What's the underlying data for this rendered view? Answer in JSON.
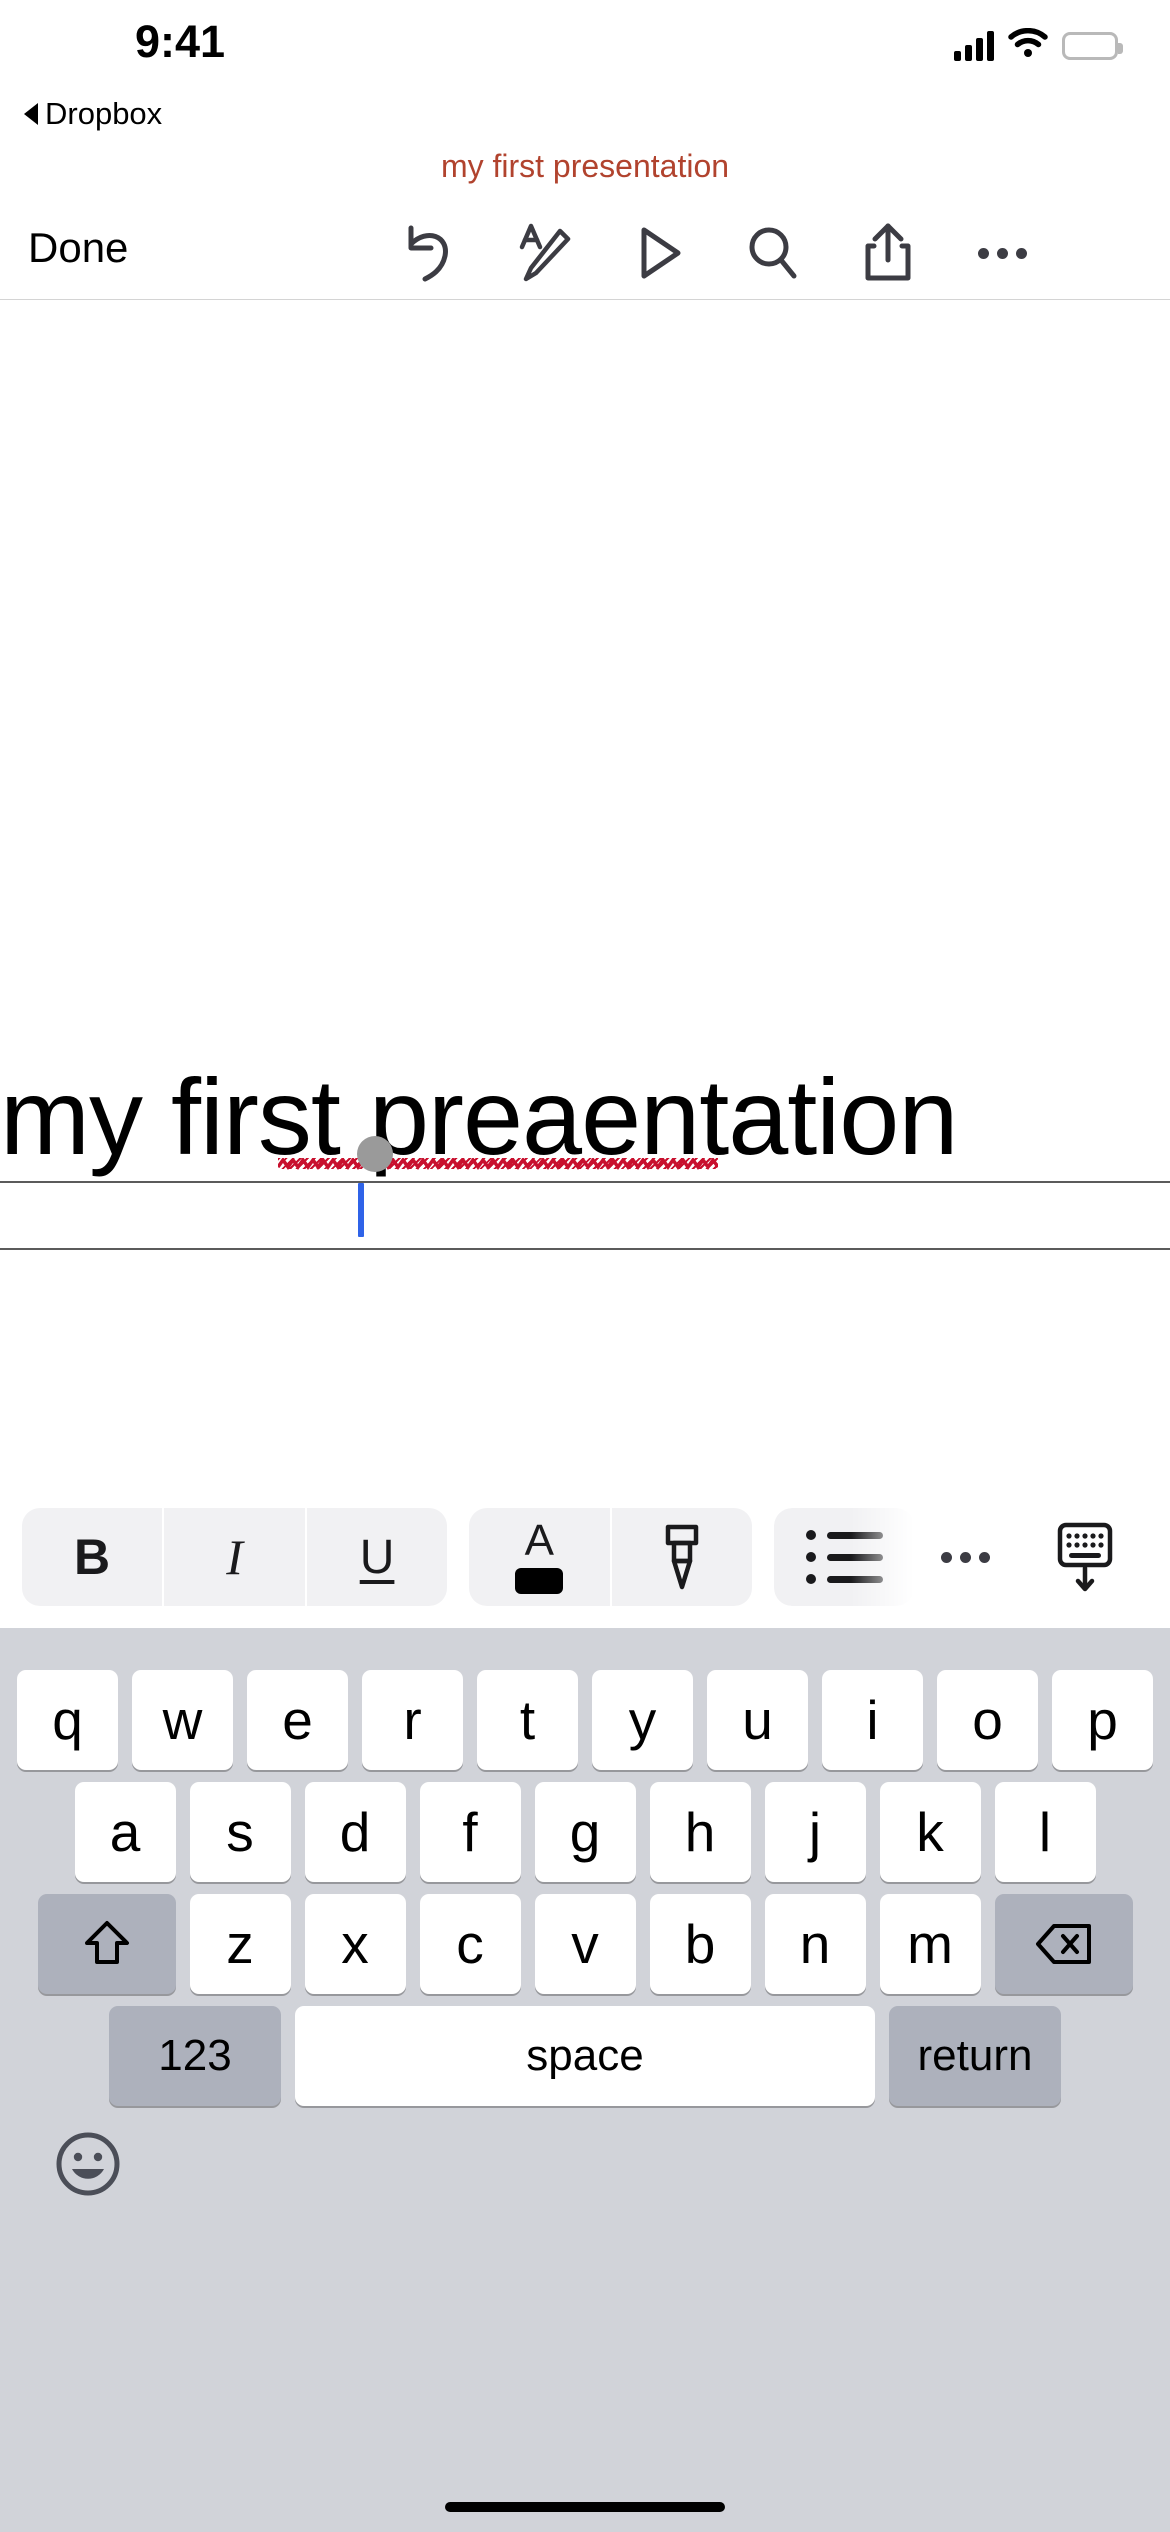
{
  "status_bar": {
    "time": "9:41",
    "signal_icon": "cellular-bars-icon",
    "wifi_icon": "wifi-icon",
    "battery_icon": "battery-full-icon"
  },
  "back_link": {
    "label": "Dropbox",
    "icon": "back-triangle-icon"
  },
  "document": {
    "title": "my first presentation",
    "title_color": "#b1432e"
  },
  "toolbar": {
    "done_label": "Done",
    "items": [
      {
        "name": "undo-icon",
        "label": "Undo"
      },
      {
        "name": "annotate-icon",
        "label": "Annotate"
      },
      {
        "name": "play-icon",
        "label": "Play"
      },
      {
        "name": "search-icon",
        "label": "Search"
      },
      {
        "name": "share-icon",
        "label": "Share"
      },
      {
        "name": "more-icon",
        "label": "More"
      }
    ]
  },
  "slide": {
    "heading_text": "my first preaentation",
    "misspelled_word": "preaentation",
    "caret_color": "#2f63e8",
    "handle_color": "#9a9a9a",
    "divider_color": "#5b5b5b",
    "spellcheck_color": "#c8102e"
  },
  "format_bar": {
    "bold_label": "B",
    "italic_label": "I",
    "underline_label": "U",
    "text_color_label": "A",
    "items": [
      {
        "name": "bold-button",
        "label": "B"
      },
      {
        "name": "italic-button",
        "label": "I"
      },
      {
        "name": "underline-button",
        "label": "U"
      },
      {
        "name": "text-color-button",
        "label": "A"
      },
      {
        "name": "highlighter-button",
        "label": "Highlight"
      },
      {
        "name": "bullet-list-button",
        "label": "List"
      },
      {
        "name": "more-format-button",
        "label": "More"
      },
      {
        "name": "hide-keyboard-button",
        "label": "Hide Keyboard"
      }
    ]
  },
  "keyboard": {
    "row1": [
      "q",
      "w",
      "e",
      "r",
      "t",
      "y",
      "u",
      "i",
      "o",
      "p"
    ],
    "row2": [
      "a",
      "s",
      "d",
      "f",
      "g",
      "h",
      "j",
      "k",
      "l"
    ],
    "row3_letters": [
      "z",
      "x",
      "c",
      "v",
      "b",
      "n",
      "m"
    ],
    "shift_icon": "shift-arrow-icon",
    "backspace_icon": "backspace-icon",
    "numbers_label": "123",
    "space_label": "space",
    "return_label": "return",
    "emoji_icon": "emoji-smiley-icon"
  }
}
